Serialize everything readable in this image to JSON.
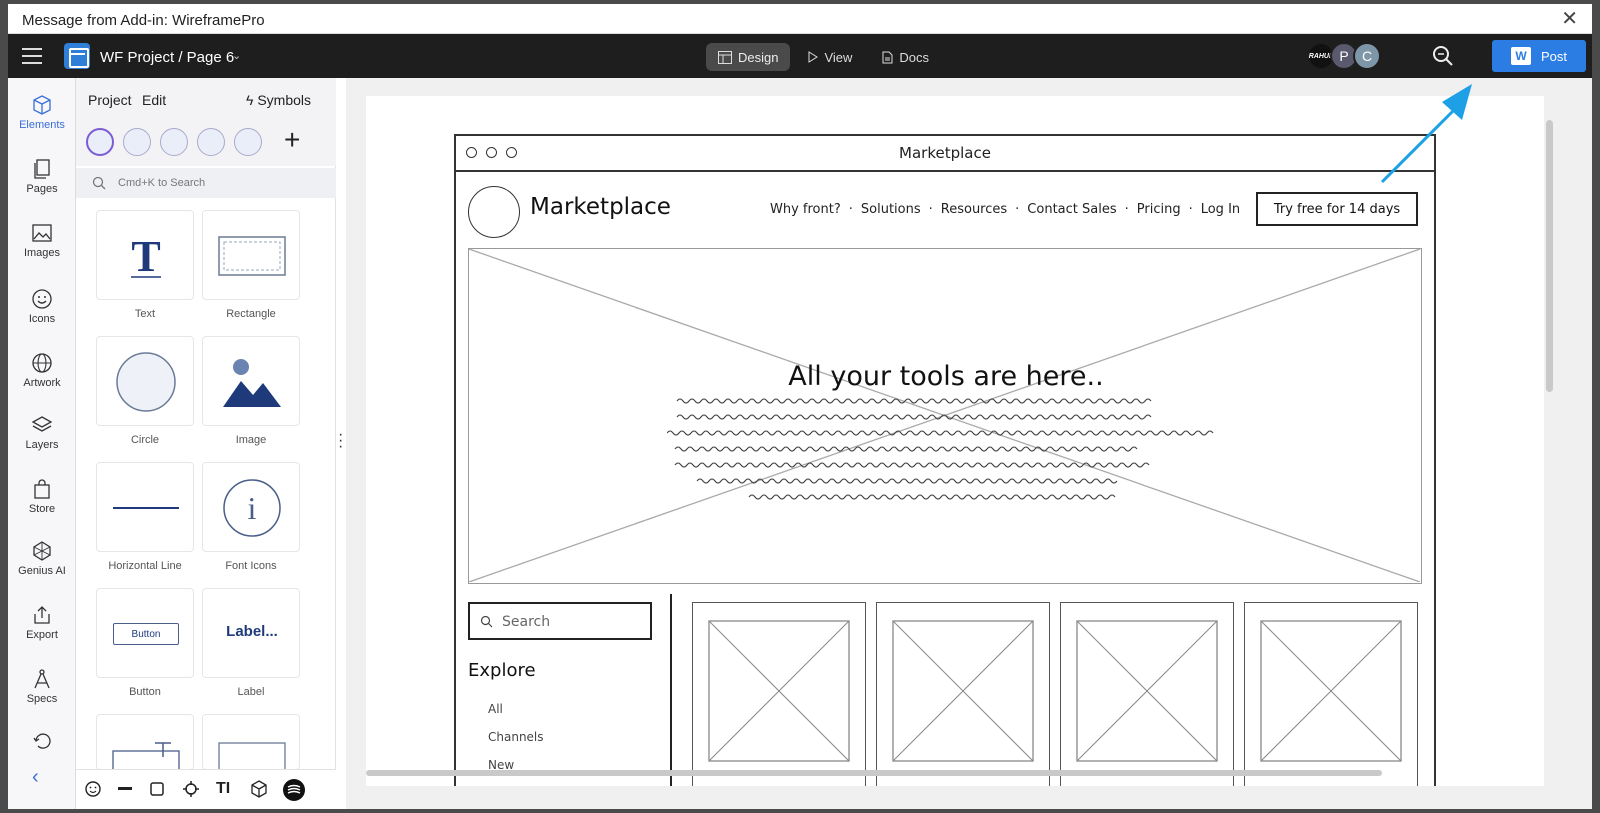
{
  "dialog": {
    "title": "Message from Add-in: WireframePro",
    "close": "✕"
  },
  "topbar": {
    "project_title": "WF Project / Page 6",
    "modes": [
      {
        "label": "Design",
        "active": true
      },
      {
        "label": "View",
        "active": false
      },
      {
        "label": "Docs",
        "active": false
      }
    ],
    "avatars": [
      {
        "label": "RAHUL",
        "color": "#111111"
      },
      {
        "label": "P",
        "color": "#5a5a6e"
      },
      {
        "label": "C",
        "color": "#7d97a8"
      }
    ],
    "post_label": "Post"
  },
  "rail": {
    "items": [
      {
        "label": "Elements",
        "icon": "cube-icon",
        "active": true
      },
      {
        "label": "Pages",
        "icon": "pages-icon"
      },
      {
        "label": "Images",
        "icon": "images-icon"
      },
      {
        "label": "Icons",
        "icon": "smiley-icon"
      },
      {
        "label": "Artwork",
        "icon": "globe-icon"
      },
      {
        "label": "Layers",
        "icon": "layers-icon"
      },
      {
        "label": "Store",
        "icon": "store-bag-icon"
      },
      {
        "label": "Genius AI",
        "icon": "genius-ai-icon"
      },
      {
        "label": "Export",
        "icon": "export-icon"
      },
      {
        "label": "Specs",
        "icon": "compass-icon"
      }
    ]
  },
  "library": {
    "tabs": {
      "project": "Project",
      "edit": "Edit",
      "symbols": "Symbols"
    },
    "search_placeholder": "Cmd+K to Search",
    "tiles": [
      {
        "label": "Text"
      },
      {
        "label": "Rectangle"
      },
      {
        "label": "Circle"
      },
      {
        "label": "Image"
      },
      {
        "label": "Horizontal Line"
      },
      {
        "label": "Font Icons"
      },
      {
        "label": "Button",
        "inner": "Button"
      },
      {
        "label": "Label",
        "inner": "Label..."
      }
    ]
  },
  "wireframe": {
    "window_title": "Marketplace",
    "brand": "Marketplace",
    "nav": [
      "Why front?",
      "Solutions",
      "Resources",
      "Contact Sales",
      "Pricing",
      "Log In"
    ],
    "cta": "Try free for 14 days",
    "hero_heading": "All your tools are here..",
    "search_placeholder": "Search",
    "explore_heading": "Explore",
    "categories": [
      "All",
      "Channels",
      "New"
    ]
  },
  "colors": {
    "accent": "#2b7de3",
    "arrow": "#1ea0e6",
    "topbar": "#1e1e1e"
  }
}
